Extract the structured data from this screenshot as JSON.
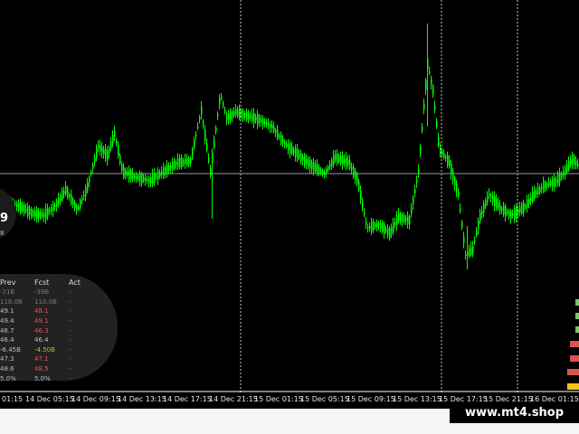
{
  "chart": {
    "type": "candlestick",
    "colors": {
      "background": "#000000",
      "candle": "#00ff00",
      "grid": "#c8c8c8",
      "price_line": "#9a9a9a"
    },
    "time_labels": [
      "01:15",
      "14 Dec 05:15",
      "14 Dec 09:15",
      "14 Dec 13:15",
      "14 Dec 17:15",
      "14 Dec 21:15",
      "15 Dec 01:15",
      "15 Dec 05:15",
      "15 Dec 09:15",
      "15 Dec 13:15",
      "15 Dec 17:15",
      "15 Dec 21:15",
      "16 Dec 01:15"
    ]
  },
  "price_badge": {
    "value": "9",
    "sub": "8"
  },
  "calendar": {
    "headers": {
      "prev": "Prev",
      "fcst": "Fcst",
      "act": "Act"
    },
    "rows": [
      {
        "prev": "-21B",
        "fcst": "-39B",
        "act": "-",
        "prev_color": "#777777",
        "fcst_color": "#777777"
      },
      {
        "prev": "118.0B",
        "fcst": "110.0B",
        "act": "-",
        "prev_color": "#777777",
        "fcst_color": "#777777"
      },
      {
        "prev": "49.1",
        "fcst": "48.1",
        "act": "-",
        "prev_color": "#bdbdbd",
        "fcst_color": "#e05555"
      },
      {
        "prev": "49.4",
        "fcst": "49.1",
        "act": "-",
        "prev_color": "#bdbdbd",
        "fcst_color": "#e05555"
      },
      {
        "prev": "46.7",
        "fcst": "46.3",
        "act": "-",
        "prev_color": "#bdbdbd",
        "fcst_color": "#e05555"
      },
      {
        "prev": "46.4",
        "fcst": "46.4",
        "act": "-",
        "prev_color": "#bdbdbd",
        "fcst_color": "#bdbdbd"
      },
      {
        "prev": "-6.45B",
        "fcst": "-4.50B",
        "act": "-",
        "prev_color": "#bdbdbd",
        "fcst_color": "#8fd44a"
      },
      {
        "prev": "47.3",
        "fcst": "47.1",
        "act": "-",
        "prev_color": "#bdbdbd",
        "fcst_color": "#e05555"
      },
      {
        "prev": "48.6",
        "fcst": "48.5",
        "act": "-",
        "prev_color": "#bdbdbd",
        "fcst_color": "#e05555"
      },
      {
        "prev": "5.0%",
        "fcst": "5.0%",
        "act": "-",
        "prev_color": "#bdbdbd",
        "fcst_color": "#bdbdbd"
      }
    ]
  },
  "strength_colors": [
    "#7ac76a",
    "#7ac76a",
    "#7ac76a",
    "#d9534f",
    "#d9534f",
    "#d9534f",
    "#f0c419"
  ],
  "watermark": "www.mt4.shop"
}
